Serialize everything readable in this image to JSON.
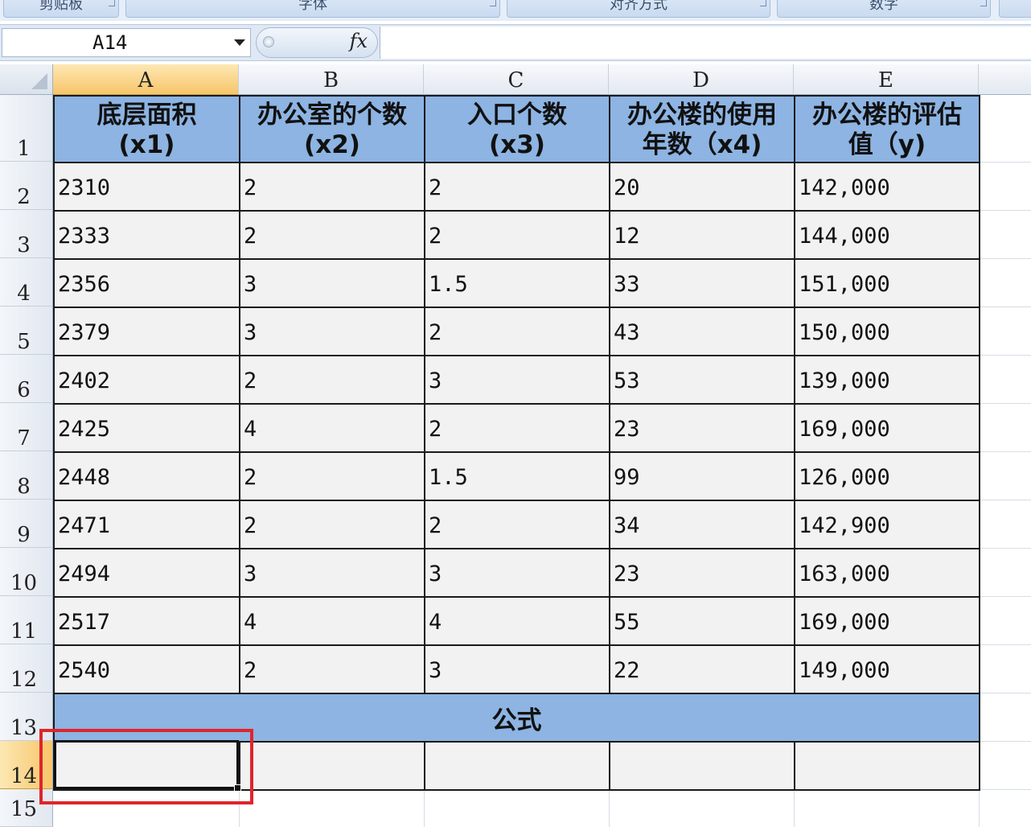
{
  "ribbon": {
    "groups": [
      "剪贴板",
      "字体",
      "对齐方式",
      "数字"
    ]
  },
  "formula_bar": {
    "name_box": "A14",
    "fx_label": "fx",
    "formula": ""
  },
  "columns": [
    "A",
    "B",
    "C",
    "D",
    "E"
  ],
  "rows": [
    "1",
    "2",
    "3",
    "4",
    "5",
    "6",
    "7",
    "8",
    "9",
    "10",
    "11",
    "12",
    "13",
    "14",
    "15"
  ],
  "selected": {
    "column": "A",
    "row": "14"
  },
  "table": {
    "headers": [
      [
        "底层面积",
        "(x1)"
      ],
      [
        "办公室的个数",
        "(x2)"
      ],
      [
        "入口个数",
        "(x3)"
      ],
      [
        "办公楼的使用",
        "年数（x4)"
      ],
      [
        "办公楼的评估",
        "值（y)"
      ]
    ],
    "data": [
      [
        "2310",
        "2",
        "2",
        "20",
        "142,000"
      ],
      [
        "2333",
        "2",
        "2",
        "12",
        "144,000"
      ],
      [
        "2356",
        "3",
        "1.5",
        "33",
        "151,000"
      ],
      [
        "2379",
        "3",
        "2",
        "43",
        "150,000"
      ],
      [
        "2402",
        "2",
        "3",
        "53",
        "139,000"
      ],
      [
        "2425",
        "4",
        "2",
        "23",
        "169,000"
      ],
      [
        "2448",
        "2",
        "1.5",
        "99",
        "126,000"
      ],
      [
        "2471",
        "2",
        "2",
        "34",
        "142,900"
      ],
      [
        "2494",
        "3",
        "3",
        "23",
        "163,000"
      ],
      [
        "2517",
        "4",
        "4",
        "55",
        "169,000"
      ],
      [
        "2540",
        "2",
        "3",
        "22",
        "149,000"
      ]
    ],
    "formula_label": "公式"
  },
  "colors": {
    "header_fill": "#8db4e2",
    "cell_fill": "#f2f2f2",
    "selection_header": "#f7c56a",
    "annotation": "#e0252b"
  }
}
